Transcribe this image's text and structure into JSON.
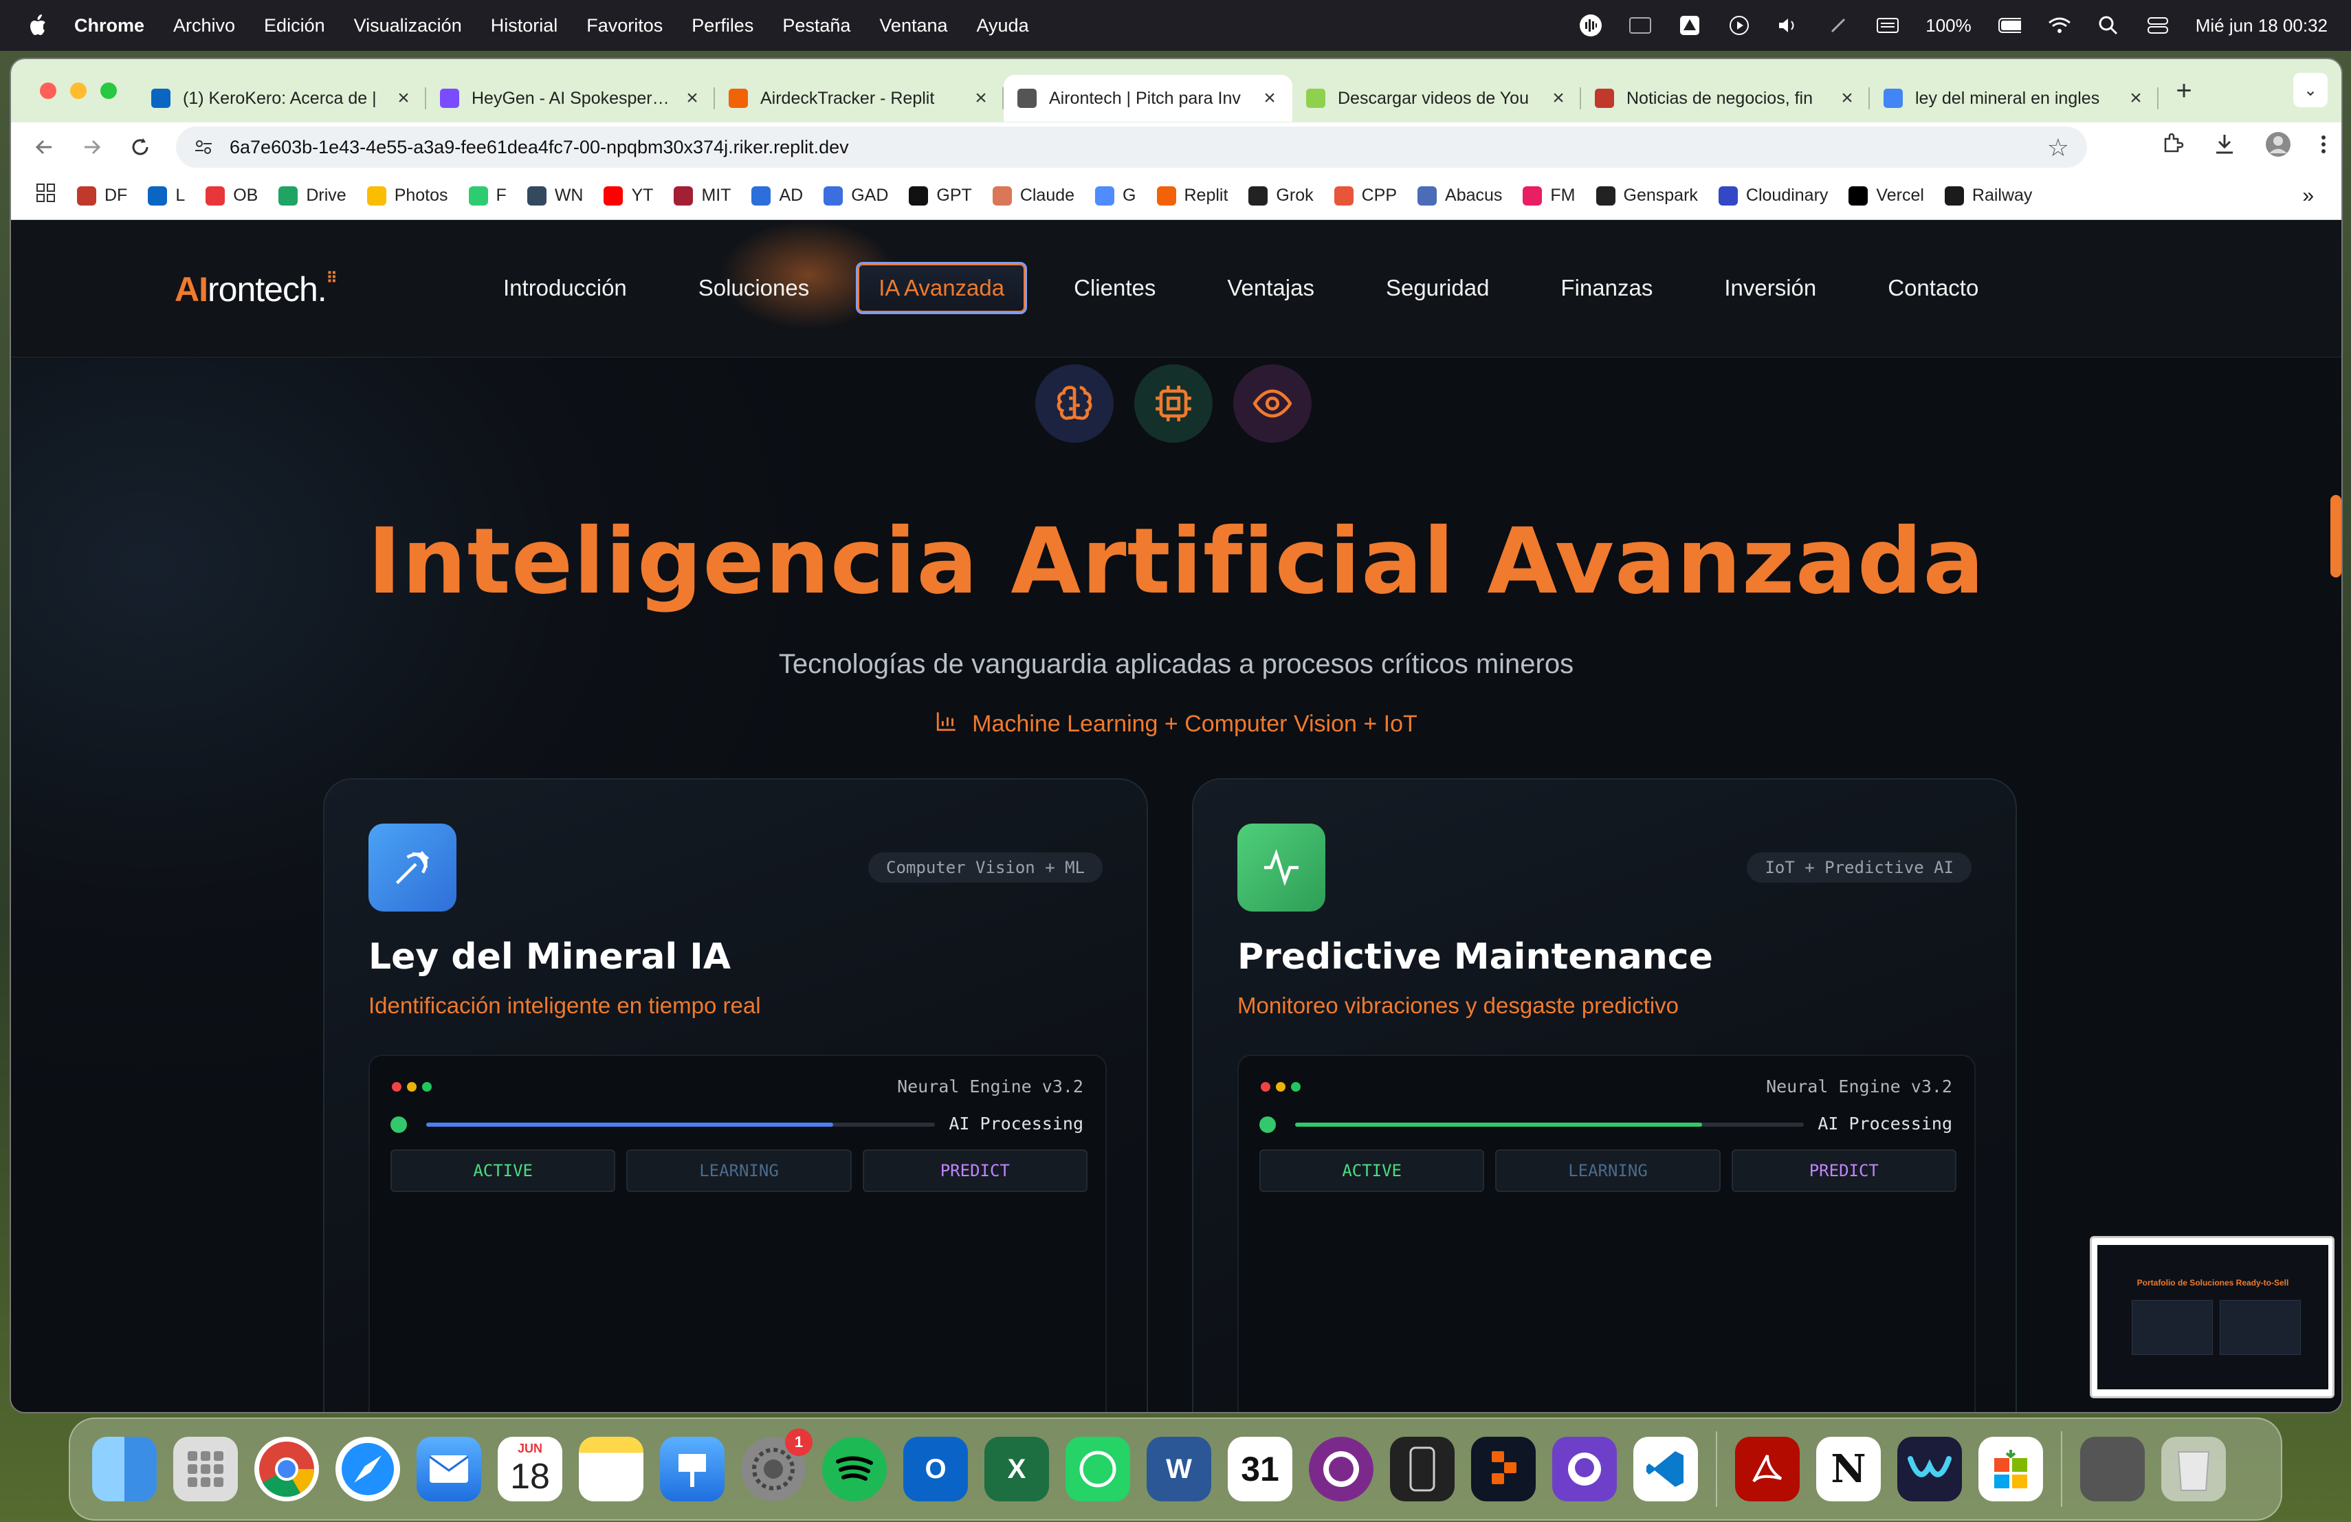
{
  "menubar": {
    "app": "Chrome",
    "items": [
      "Archivo",
      "Edición",
      "Visualización",
      "Historial",
      "Favoritos",
      "Perfiles",
      "Pestaña",
      "Ventana",
      "Ayuda"
    ],
    "battery": "100%",
    "datetime": "Mié jun 18  00:32"
  },
  "tabs": [
    {
      "title": "(1) KeroKero: Acerca de |",
      "color": "#0a66c2"
    },
    {
      "title": "HeyGen - AI Spokesperson",
      "color": "#7b4cff"
    },
    {
      "title": "AirdeckTracker - Replit",
      "color": "#f26207"
    },
    {
      "title": "Airontech | Pitch para Inv",
      "color": "#555555",
      "active": true
    },
    {
      "title": "Descargar videos de You",
      "color": "#8fd14f"
    },
    {
      "title": "Noticias de negocios, fin",
      "color": "#c0392b"
    },
    {
      "title": "ley del mineral en ingles",
      "color": "#4285f4"
    }
  ],
  "address": {
    "url": "6a7e603b-1e43-4e55-a3a9-fee61dea4fc7-00-npqbm30x374j.riker.replit.dev"
  },
  "bookmarks": [
    {
      "label": "DF",
      "color": "#c0392b"
    },
    {
      "label": "L",
      "color": "#0a66c2"
    },
    {
      "label": "OB",
      "color": "#e8363a"
    },
    {
      "label": "Drive",
      "color": "#1fa463"
    },
    {
      "label": "Photos",
      "color": "#fbbc04"
    },
    {
      "label": "F",
      "color": "#2ecc71"
    },
    {
      "label": "WN",
      "color": "#34495e"
    },
    {
      "label": "YT",
      "color": "#ff0000"
    },
    {
      "label": "MIT",
      "color": "#a31f34"
    },
    {
      "label": "AD",
      "color": "#2c6fdb"
    },
    {
      "label": "GAD",
      "color": "#3b6fe0"
    },
    {
      "label": "GPT",
      "color": "#111111"
    },
    {
      "label": "Claude",
      "color": "#d97757"
    },
    {
      "label": "G",
      "color": "#4e8cff"
    },
    {
      "label": "Replit",
      "color": "#f26207"
    },
    {
      "label": "Grok",
      "color": "#222222"
    },
    {
      "label": "CPP",
      "color": "#e8563a"
    },
    {
      "label": "Abacus",
      "color": "#4b6cb7"
    },
    {
      "label": "FM",
      "color": "#e91e63"
    },
    {
      "label": "Genspark",
      "color": "#222222"
    },
    {
      "label": "Cloudinary",
      "color": "#3448c5"
    },
    {
      "label": "Vercel",
      "color": "#000000"
    },
    {
      "label": "Railway",
      "color": "#1b1b1b"
    }
  ],
  "site": {
    "logo_ai": "AI",
    "logo_rest": "rontech.",
    "nav": [
      "Introducción",
      "Soluciones",
      "IA Avanzada",
      "Clientes",
      "Ventajas",
      "Seguridad",
      "Finanzas",
      "Inversión",
      "Contacto"
    ],
    "active_nav": "IA Avanzada",
    "accent": "#f07a2e"
  },
  "hero": {
    "title": "Inteligencia Artificial Avanzada",
    "subtitle": "Tecnologías de vanguardia aplicadas a procesos críticos mineros",
    "tagline": "Machine Learning + Computer Vision + IoT",
    "icons": [
      "brain-icon",
      "cpu-icon",
      "eye-icon"
    ]
  },
  "cards": [
    {
      "badge": "Computer Vision + ML",
      "title": "Ley del Mineral IA",
      "subtitle": "Identificación inteligente en tiempo real",
      "icon": "pickaxe-icon",
      "icon_color": "#3b8ee8",
      "engine": "Neural Engine v3.2",
      "processing": "AI Processing",
      "progress": 0.8,
      "bar_color": "#4d7ff0",
      "states": [
        "ACTIVE",
        "LEARNING",
        "PREDICT"
      ]
    },
    {
      "badge": "IoT + Predictive AI",
      "title": "Predictive Maintenance",
      "subtitle": "Monitoreo vibraciones y desgaste predictivo",
      "icon": "activity-icon",
      "icon_color": "#3fbf6a",
      "engine": "Neural Engine v3.2",
      "processing": "AI Processing",
      "progress": 0.8,
      "bar_color": "#34c76b",
      "states": [
        "ACTIVE",
        "LEARNING",
        "PREDICT"
      ]
    }
  ],
  "thumbnail": {
    "title": "Portafolio de Soluciones Ready-to-Sell"
  },
  "dock": {
    "calendar_month": "JUN",
    "calendar_day": "18",
    "notif_count": "1",
    "apps": [
      "finder-icon",
      "launchpad-icon",
      "chrome-icon",
      "safari-icon",
      "mail-icon",
      "calendar-icon",
      "notes-icon",
      "keynote-icon",
      "settings-icon",
      "spotify-icon",
      "outlook-icon",
      "excel-icon",
      "whatsapp-icon",
      "word-icon",
      "calendar31-icon",
      "app-icon",
      "iphone-mirroring-icon",
      "replit-icon",
      "github-icon",
      "vscode-icon",
      "acrobat-icon",
      "notion-icon",
      "webex-icon",
      "office-icon",
      "downloads-icon",
      "trash-icon"
    ]
  }
}
